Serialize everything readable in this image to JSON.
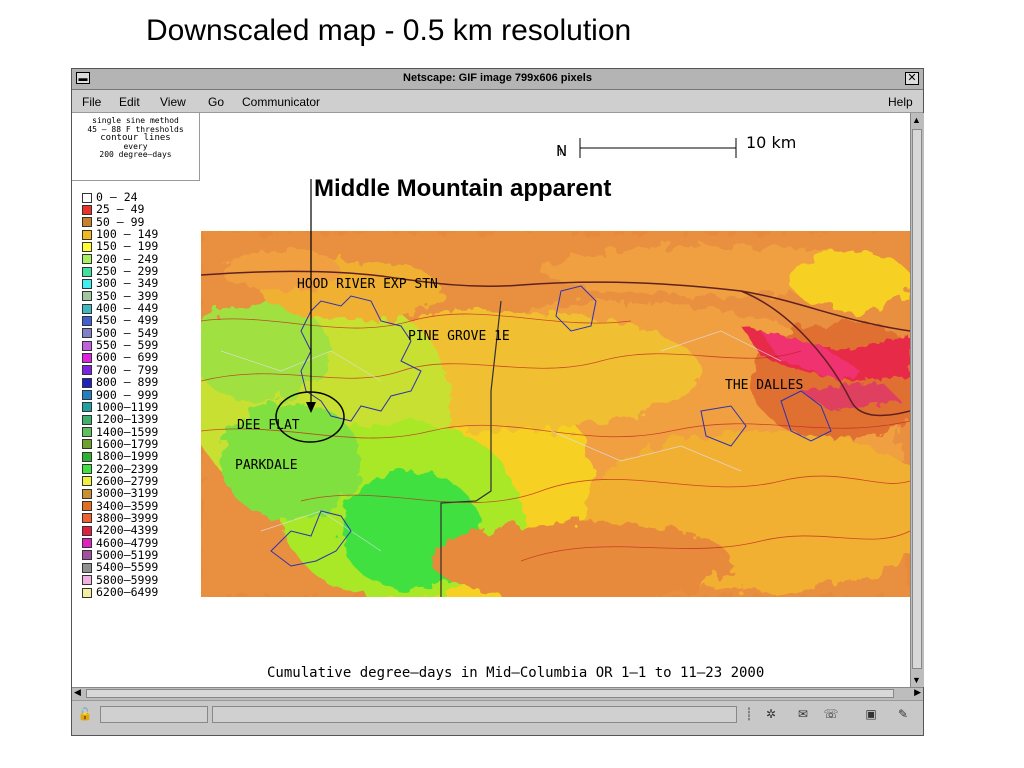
{
  "slide_title": "Downscaled map - 0.5 km resolution",
  "window": {
    "title": "Netscape: GIF image 799x606 pixels",
    "menu": [
      "File",
      "Edit",
      "View",
      "Go",
      "Communicator"
    ],
    "help": "Help"
  },
  "method_note": [
    "single sine method",
    "45 – 88 F thresholds",
    "contour lines",
    "every",
    "200 degree–days"
  ],
  "legend": [
    {
      "label": "0 – 24",
      "color": "#ffffff"
    },
    {
      "label": "25 – 49",
      "color": "#e8332a"
    },
    {
      "label": "50 – 99",
      "color": "#c8822a"
    },
    {
      "label": "100 – 149",
      "color": "#f2b81e"
    },
    {
      "label": "150 – 199",
      "color": "#ffff30"
    },
    {
      "label": "200 – 249",
      "color": "#a8f060"
    },
    {
      "label": "250 – 299",
      "color": "#40e0a0"
    },
    {
      "label": "300 – 349",
      "color": "#40f0f0"
    },
    {
      "label": "350 – 399",
      "color": "#a0c8a0"
    },
    {
      "label": "400 – 449",
      "color": "#40b8c0"
    },
    {
      "label": "450 – 499",
      "color": "#4060d0"
    },
    {
      "label": "500 – 549",
      "color": "#8080c8"
    },
    {
      "label": "550 – 599",
      "color": "#c060e0"
    },
    {
      "label": "600 – 699",
      "color": "#e020e0"
    },
    {
      "label": "700 – 799",
      "color": "#8020e0"
    },
    {
      "label": "800 – 899",
      "color": "#2020c0"
    },
    {
      "label": "900 – 999",
      "color": "#2080c0"
    },
    {
      "label": "1000–1199",
      "color": "#20a0a0"
    },
    {
      "label": "1200–1399",
      "color": "#40b070"
    },
    {
      "label": "1400–1599",
      "color": "#60c060"
    },
    {
      "label": "1600–1799",
      "color": "#70a030"
    },
    {
      "label": "1800–1999",
      "color": "#30b030"
    },
    {
      "label": "2200–2399",
      "color": "#40e040"
    },
    {
      "label": "2600–2799",
      "color": "#f0f040"
    },
    {
      "label": "3000–3199",
      "color": "#c89030"
    },
    {
      "label": "3400–3599",
      "color": "#e07020"
    },
    {
      "label": "3800–3999",
      "color": "#f06030"
    },
    {
      "label": "4200–4399",
      "color": "#e02040"
    },
    {
      "label": "4600–4799",
      "color": "#e020c0"
    },
    {
      "label": "5000–5199",
      "color": "#a050a0"
    },
    {
      "label": "5400–5599",
      "color": "#909090"
    },
    {
      "label": "5800–5999",
      "color": "#f0b0e0"
    },
    {
      "label": "6200–6499",
      "color": "#f0f0a0"
    }
  ],
  "scale": {
    "north": "N",
    "label": "10 km"
  },
  "callout": "Middle Mountain apparent",
  "places": {
    "hood_river": "HOOD RIVER EXP STN",
    "pine_grove": "PINE GROVE 1E",
    "the_dalles": "THE DALLES",
    "dee_flat": "DEE FLAT",
    "parkdale": "PARKDALE"
  },
  "caption": "Cumulative degree–days in Mid–Columbia OR 1–1 to 11–23 2000"
}
